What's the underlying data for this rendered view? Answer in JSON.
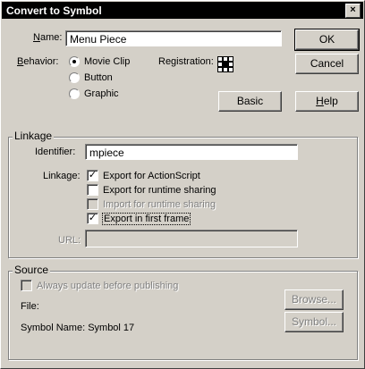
{
  "window": {
    "title": "Convert to Symbol",
    "close_glyph": "×"
  },
  "name": {
    "label_u": "N",
    "label_rest": "ame:",
    "value": "Menu Piece"
  },
  "behavior": {
    "label_u": "B",
    "label_rest": "ehavior:",
    "options": [
      "Movie Clip",
      "Button",
      "Graphic"
    ],
    "selected": "Movie Clip"
  },
  "registration": {
    "label": "Registration:"
  },
  "buttons": {
    "ok": "OK",
    "cancel": "Cancel",
    "basic": "Basic",
    "help_u": "H",
    "help_rest": "elp"
  },
  "linkage": {
    "legend": "Linkage",
    "identifier_label": "Identifier:",
    "identifier_value": "mpiece",
    "linkage_label": "Linkage:",
    "options": [
      {
        "label": "Export for ActionScript",
        "checked": true,
        "enabled": true
      },
      {
        "label": "Export for runtime sharing",
        "checked": false,
        "enabled": true
      },
      {
        "label": "Import for runtime sharing",
        "checked": false,
        "enabled": false
      },
      {
        "label": "Export in first frame",
        "checked": true,
        "enabled": true
      }
    ],
    "url_label": "URL:",
    "url_value": ""
  },
  "source": {
    "legend": "Source",
    "always_update": "Always update before publishing",
    "file_label": "File:",
    "symbol_name_label": "Symbol Name: Symbol 17",
    "browse": "Browse...",
    "symbol": "Symbol..."
  }
}
